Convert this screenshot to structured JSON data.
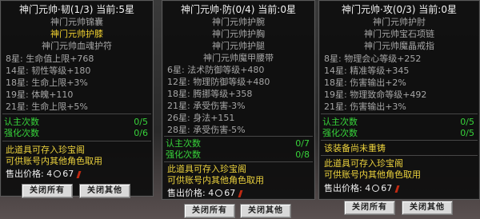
{
  "panels": [
    {
      "title": "神门元帅·韧(1/3) 当前:5星",
      "set_items": [
        {
          "text": "神门元帅锦囊",
          "active": false
        },
        {
          "text": "神门元帅护膝",
          "active": true
        },
        {
          "text": "神门元帅血魂护符",
          "active": false
        }
      ],
      "attrs": [
        "8星: 生命值上限+768",
        "14星: 韧性等级+180",
        "18星: 生命上限+3%",
        "19星: 体魄+110",
        "21星: 生命上限+5%"
      ],
      "status": [
        {
          "label": "认主次数",
          "value": "0/5"
        },
        {
          "label": "强化次数",
          "value": "0/6"
        }
      ],
      "notes": [
        "此道具可存入珍宝阁",
        "可供账号内其他角色取用"
      ],
      "price": {
        "label": "售出价格:",
        "before": "4",
        "after": "67"
      },
      "buttons": [
        "关闭所有",
        "关闭其他"
      ]
    },
    {
      "title": "神门元帅·防(0/4) 当前:0星",
      "set_items": [
        {
          "text": "神门元帅护腕",
          "active": false
        },
        {
          "text": "神门元帅护胸",
          "active": false
        },
        {
          "text": "神门元帅护腿",
          "active": false
        },
        {
          "text": "神门元帅魔甲腰带",
          "active": false
        }
      ],
      "attrs": [
        "6星: 法术防御等级+480",
        "12星: 物理防御等级+480",
        "18星: 腾挪等级+358",
        "21星: 承受伤害-3%",
        "26星: 身法+151",
        "28星: 承受伤害-5%"
      ],
      "status": [
        {
          "label": "认主次数",
          "value": "0/7"
        },
        {
          "label": "强化次数",
          "value": "0/8"
        }
      ],
      "notes": [
        "此道具可存入珍宝阁",
        "可供账号内其他角色取用"
      ],
      "price": {
        "label": "售出价格:",
        "before": "4",
        "after": "67"
      },
      "buttons": [
        "关闭所有",
        "关闭其他"
      ]
    },
    {
      "title": "神门元帅·攻(0/3) 当前:0星",
      "set_items": [
        {
          "text": "神门元帅护肘",
          "active": false
        },
        {
          "text": "神门元帅宝石项链",
          "active": false
        },
        {
          "text": "神门元帅魔晶戒指",
          "active": false
        }
      ],
      "attrs": [
        "8星: 物理会心等级+252",
        "14星: 精准等级+345",
        "18星: 伤害输出+2%",
        "19星: 物理致命等级+492",
        "21星: 伤害输出+3%"
      ],
      "status": [
        {
          "label": "认主次数",
          "value": "0/5"
        },
        {
          "label": "强化次数",
          "value": "0/5"
        }
      ],
      "notes": [
        "该装备尚未重铸",
        "此道具可存入珍宝阁",
        "可供账号内其他角色取用"
      ],
      "price": {
        "label": "售出价格:",
        "before": "4",
        "after": "67"
      },
      "buttons": [
        "关闭所有",
        "关闭其他"
      ]
    }
  ]
}
